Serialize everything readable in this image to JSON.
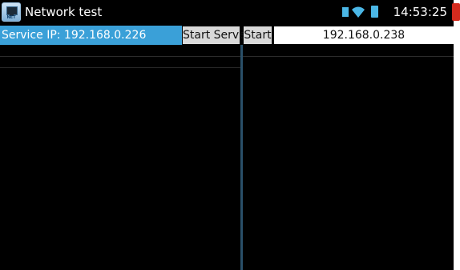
{
  "titlebar": {
    "app_title": "Network test",
    "app_icon": "network-test-app-icon",
    "app_icon_text": "NET",
    "clock": "14:53:25",
    "status_icons": [
      "sim-icon",
      "wifi-icon",
      "battery-icon",
      "close-icon"
    ],
    "accent_color": "#4bb7e6"
  },
  "toolbar": {
    "service_ip_label": "Service IP: 192.168.0.226",
    "start_server_label": "Start Server",
    "start_label": "Start",
    "target_ip_value": "192.168.0.238",
    "service_bar_color": "#3aa0d8"
  }
}
